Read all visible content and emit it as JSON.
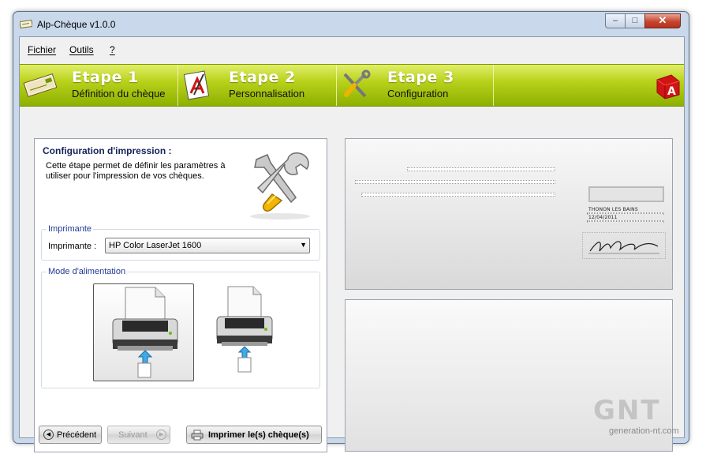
{
  "window": {
    "title": "Alp-Chèque v1.0.0",
    "controls": {
      "minimize": "–",
      "maximize": "□",
      "close": "✕"
    }
  },
  "menu": {
    "items": [
      "Fichier",
      "Outils",
      "?"
    ]
  },
  "banner": {
    "steps": [
      {
        "title": "Etape 1",
        "subtitle": "Définition du chèque",
        "icon": "cheque-icon"
      },
      {
        "title": "Etape 2",
        "subtitle": "Personnalisation",
        "icon": "customize-icon"
      },
      {
        "title": "Etape 3",
        "subtitle": "Configuration",
        "icon": "tools-icon"
      }
    ],
    "logo_letter": "A",
    "colors": {
      "green": "#a4c400",
      "accent_red": "#d21414"
    }
  },
  "left_panel": {
    "heading": "Configuration d'impression :",
    "description": "Cette étape permet de définir les paramètres à utiliser pour l'impression de vos chèques.",
    "printer_group": {
      "legend": "Imprimante",
      "label": "Imprimante :",
      "selected": "HP Color LaserJet 1600"
    },
    "feed_group": {
      "legend": "Mode d'alimentation",
      "selected_index": 0
    },
    "buttons": {
      "previous": "Précédent",
      "next": "Suivant",
      "print": "Imprimer le(s) chèque(s)"
    }
  },
  "preview": {
    "city": "THONON LES BAINS",
    "date": "12/04/2011"
  },
  "watermark": {
    "big": "GNT",
    "small": "generation-nt.com"
  }
}
